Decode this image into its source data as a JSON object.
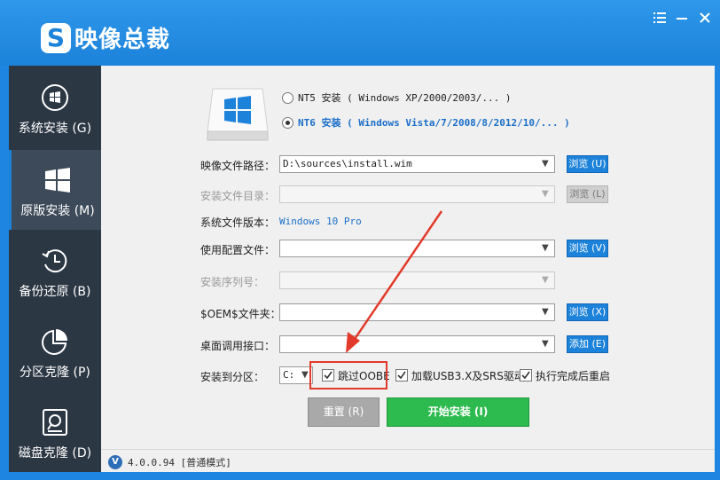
{
  "app": {
    "title": "映像总裁",
    "logo_letter": "S",
    "controls": [
      "menu-icon",
      "minimize-icon",
      "close-icon"
    ]
  },
  "sidebar": {
    "items": [
      {
        "label": "系统安装 (G)",
        "icon": "windows-disc-icon",
        "active": false
      },
      {
        "label": "原版安装 (M)",
        "icon": "windows-logo-icon",
        "active": true
      },
      {
        "label": "备份还原 (B)",
        "icon": "backup-clock-icon",
        "active": false
      },
      {
        "label": "分区克隆 (P)",
        "icon": "pie-chart-icon",
        "active": false
      },
      {
        "label": "磁盘克隆 (D)",
        "icon": "disk-search-icon",
        "active": false
      }
    ]
  },
  "install": {
    "nt5_option": "NT5 安装 ( Windows XP/2000/2003/... )",
    "nt6_option": "NT6 安装 ( Windows Vista/7/2008/8/2012/10/... )",
    "image_path": {
      "label": "映像文件路径：",
      "value": "D:\\sources\\install.wim",
      "button": "浏览 (U)"
    },
    "install_dir": {
      "label": "安装文件目录：",
      "value": "",
      "button": "浏览 (L)"
    },
    "system_version": {
      "label": "系统文件版本：",
      "value": "Windows 10 Pro"
    },
    "config_file": {
      "label": "使用配置文件：",
      "value": "",
      "button": "浏览 (V)"
    },
    "serial": {
      "label": "安装序列号：",
      "value": ""
    },
    "oem_folder": {
      "label": "$OEM$文件夹：",
      "value": "",
      "button": "浏览 (X)"
    },
    "desktop_api": {
      "label": "桌面调用接口：",
      "value": "",
      "button": "添加 (E)"
    },
    "target_partition": {
      "label": "安装到分区：",
      "value": "C:"
    },
    "options": [
      {
        "label": "跳过OOBE",
        "checked": true
      },
      {
        "label": "加载USB3.X及SRS驱动",
        "checked": true
      },
      {
        "label": "执行完成后重启",
        "checked": true
      }
    ],
    "reset_button": "重置 (R)",
    "start_button": "开始安装 (I)"
  },
  "status": {
    "badge": "V",
    "version": "4.0.0.94 [普通模式]"
  },
  "colors": {
    "accent": "#1c82da",
    "sidebar": "#2c3744",
    "start": "#2dba4e",
    "highlight": "#e23a2a"
  }
}
